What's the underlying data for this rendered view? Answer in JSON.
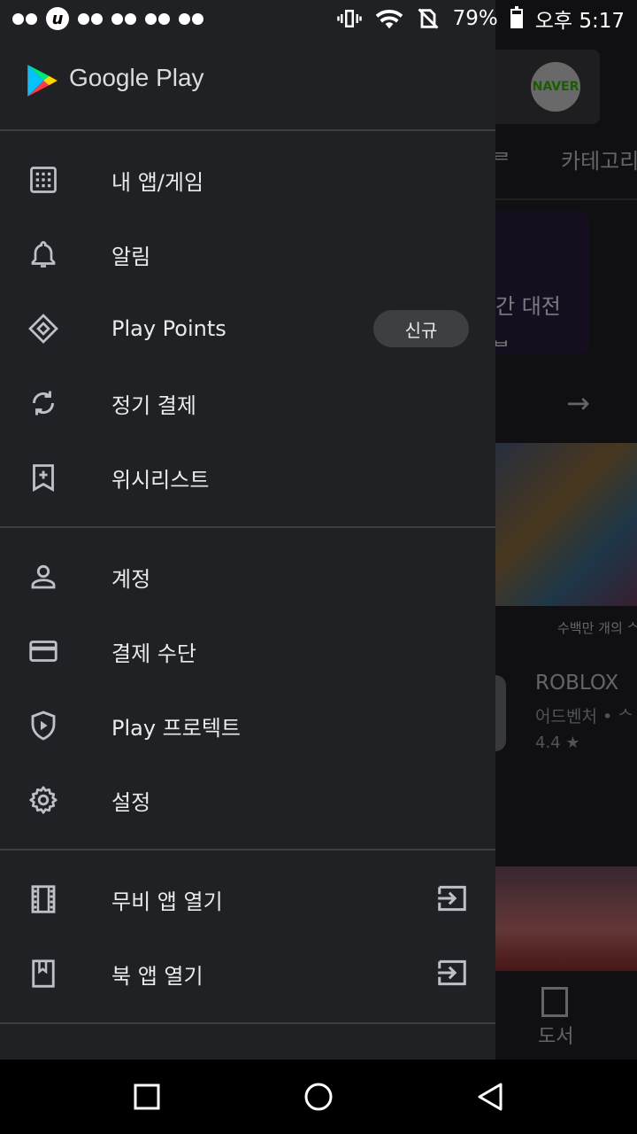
{
  "status_bar": {
    "battery": "79%",
    "time": "오후 5:17"
  },
  "background_app": {
    "avatar_text": "NAVER",
    "tab_label": "카테고리",
    "tab_label_partial": "ᄅ",
    "card_text": "간 대전",
    "card_text2": "ᆸ",
    "caption": "수백만 개의 ᄉ",
    "app_title": "ROBLOX",
    "app_subtitle": "어드벤처 • ᄉ",
    "app_rating": "4.4 ★",
    "nav_label": "도서"
  },
  "drawer": {
    "brand": "Google Play",
    "sections": [
      {
        "items": [
          {
            "label": "내 앱/게임",
            "icon": "apps-grid-icon"
          },
          {
            "label": "알림",
            "icon": "bell-icon"
          },
          {
            "label": "Play Points",
            "icon": "diamond-icon",
            "badge": "신규"
          },
          {
            "label": "정기 결제",
            "icon": "refresh-icon"
          },
          {
            "label": "위시리스트",
            "icon": "bookmark-add-icon"
          }
        ]
      },
      {
        "items": [
          {
            "label": "계정",
            "icon": "person-icon"
          },
          {
            "label": "결제 수단",
            "icon": "credit-card-icon"
          },
          {
            "label": "Play 프로텍트",
            "icon": "shield-play-icon"
          },
          {
            "label": "설정",
            "icon": "gear-icon"
          }
        ]
      },
      {
        "items": [
          {
            "label": "무비 앱 열기",
            "icon": "film-icon",
            "trailing": "open-app-icon"
          },
          {
            "label": "북 앱 열기",
            "icon": "book-icon",
            "trailing": "open-app-icon"
          }
        ]
      }
    ]
  },
  "colors": {
    "drawer_bg": "#202124",
    "text": "#e8eaed",
    "icon": "#bdc1c6",
    "divider": "#3c4043"
  }
}
